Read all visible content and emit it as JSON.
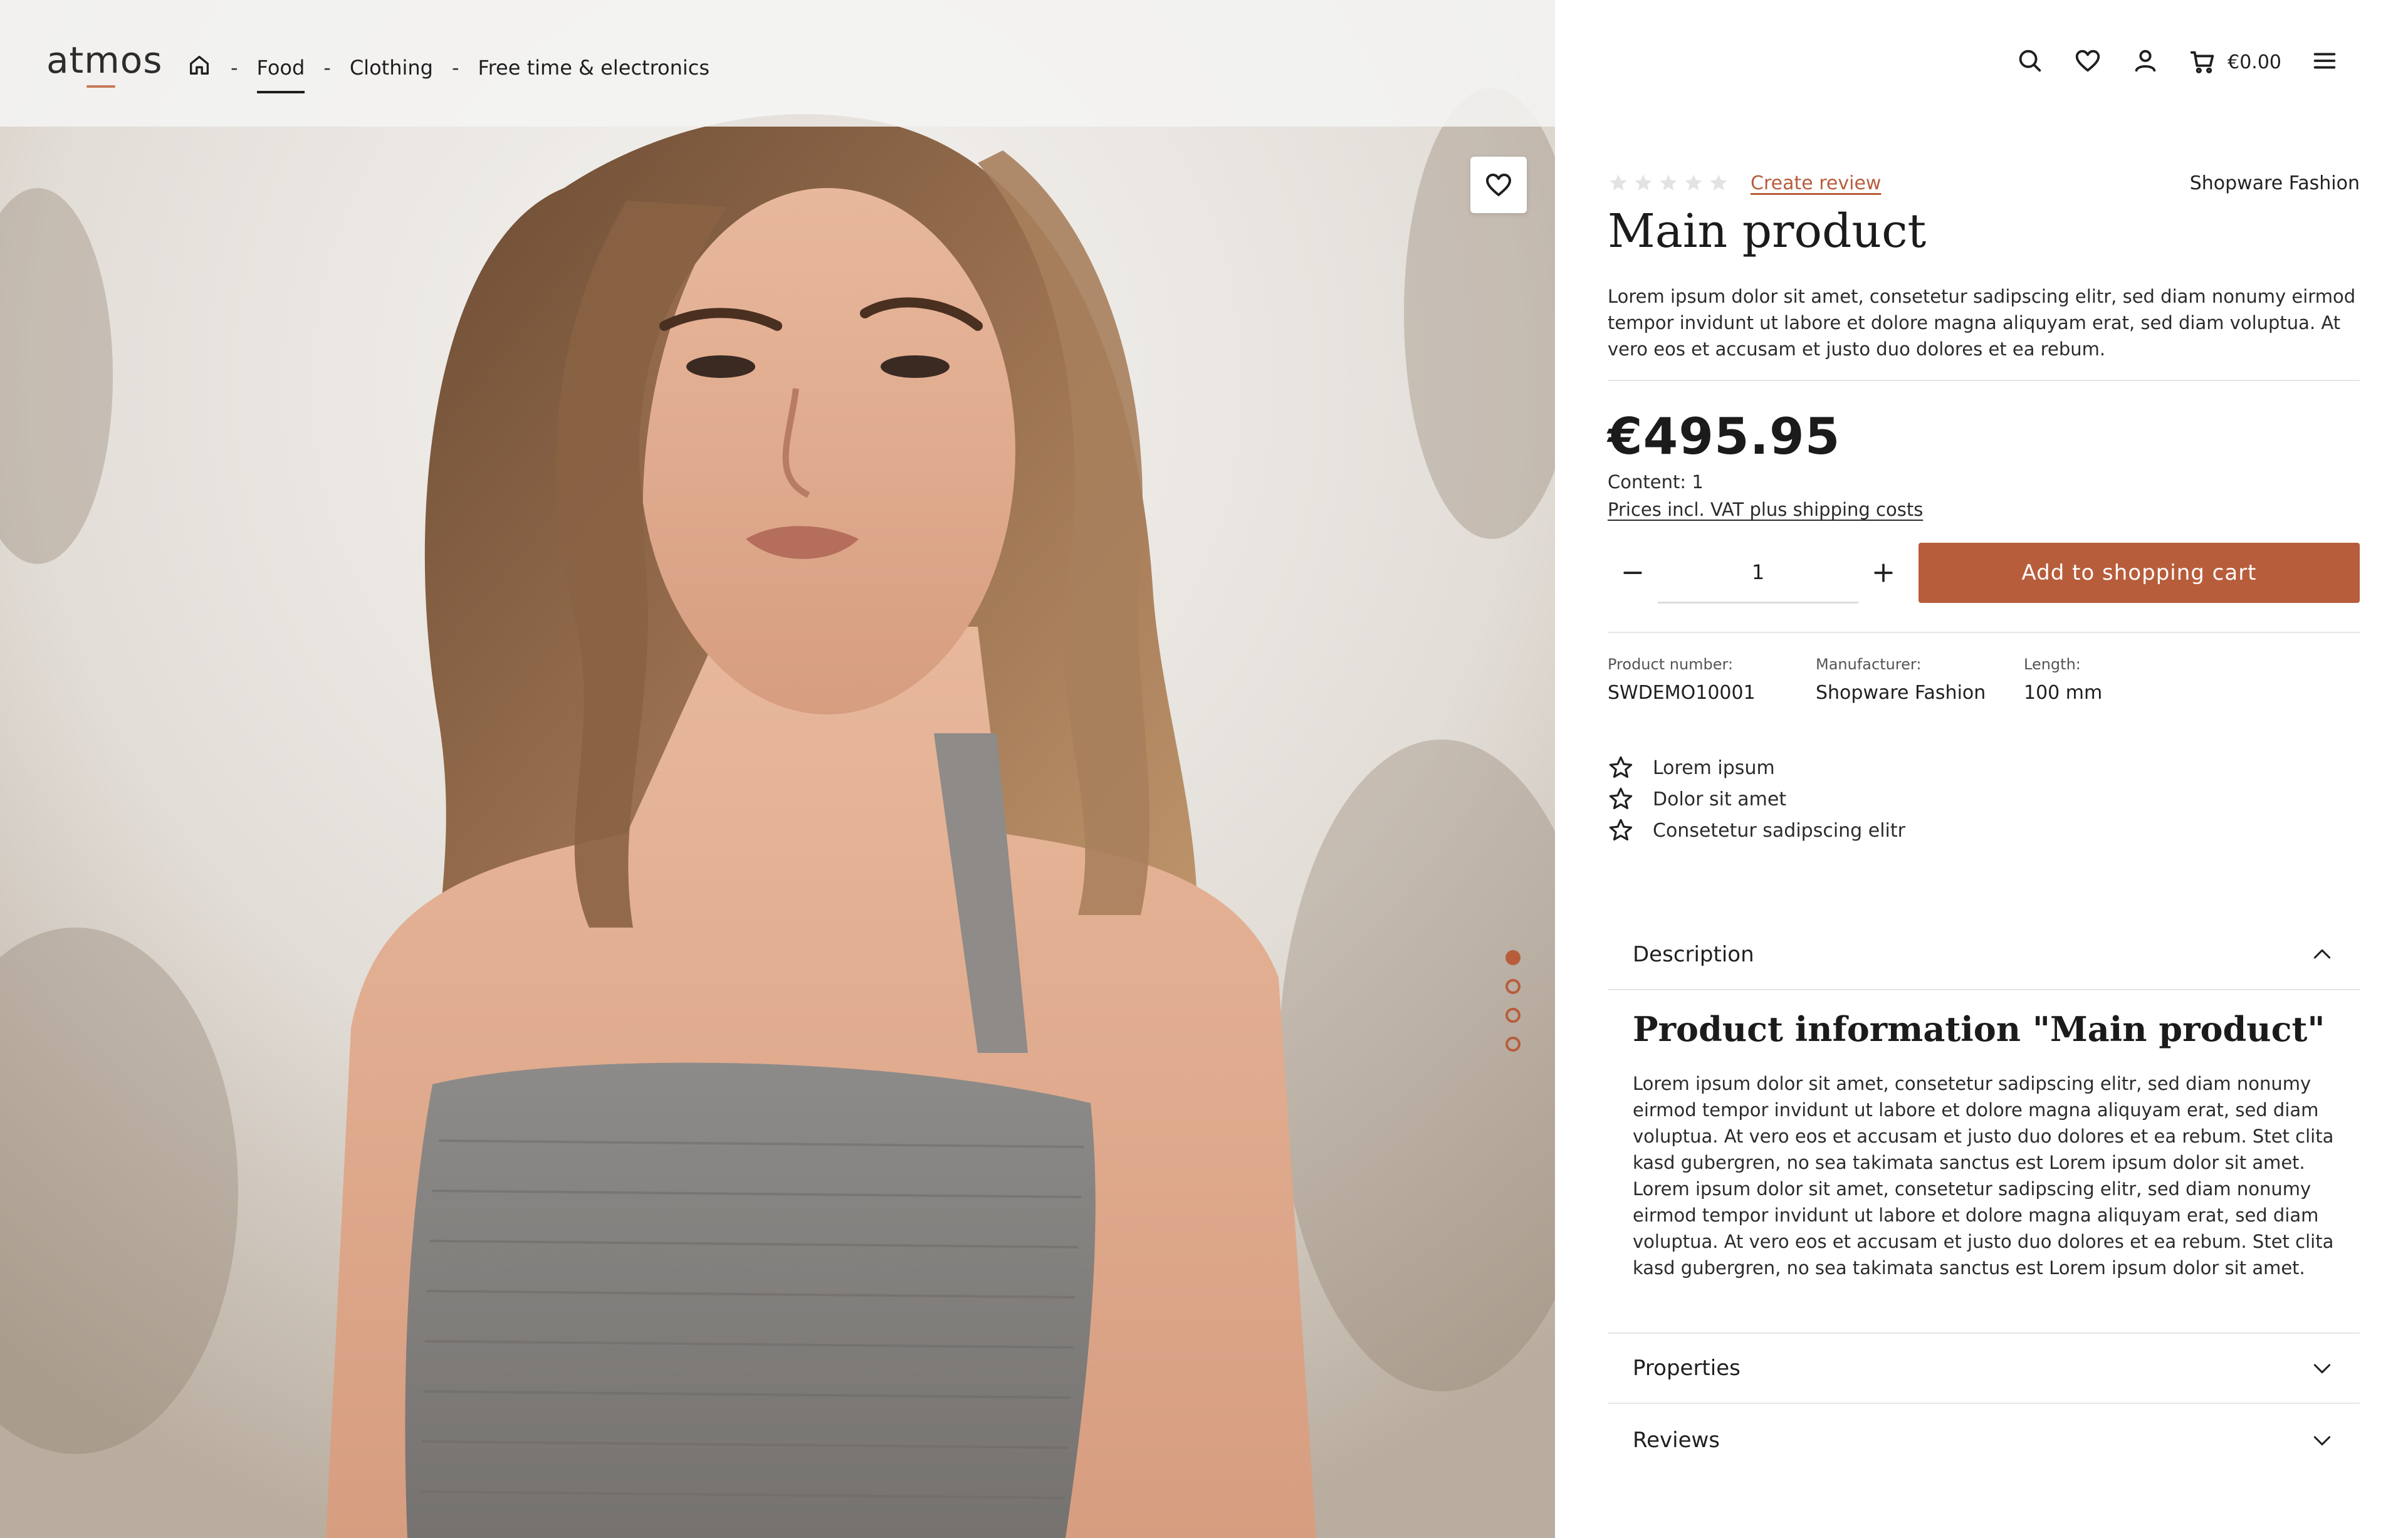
{
  "header": {
    "logo": "atmos",
    "breadcrumb": [
      "Food",
      "Clothing",
      "Free time & electronics"
    ],
    "cart_total": "€0.00"
  },
  "gallery": {
    "slide_count": 4,
    "active_slide": 1
  },
  "product": {
    "rating": 0,
    "create_review_label": "Create review",
    "brand": "Shopware Fashion",
    "title": "Main product",
    "short_description": "Lorem ipsum dolor sit amet, consetetur sadipscing elitr, sed diam nonumy eirmod tempor invidunt ut labore et dolore magna aliquyam erat, sed diam voluptua. At vero eos et accusam et justo duo dolores et ea rebum.",
    "price": "€495.95",
    "content": "Content: 1",
    "vat_note": "Prices incl. VAT plus shipping costs",
    "quantity": "1",
    "add_to_cart_label": "Add to shopping cart",
    "meta": [
      {
        "label": "Product number:",
        "value": "SWDEMO10001"
      },
      {
        "label": "Manufacturer:",
        "value": "Shopware Fashion"
      },
      {
        "label": "Length:",
        "value": "100 mm"
      }
    ],
    "features": [
      "Lorem ipsum",
      "Dolor sit amet",
      "Consetetur sadipscing elitr"
    ]
  },
  "accordion": {
    "description_label": "Description",
    "info_title": "Product information \"Main product\"",
    "info_text": "Lorem ipsum dolor sit amet, consetetur sadipscing elitr, sed diam nonumy eirmod tempor invidunt ut labore et dolore magna aliquyam erat, sed diam voluptua. At vero eos et accusam et justo duo dolores et ea rebum. Stet clita kasd gubergren, no sea takimata sanctus est Lorem ipsum dolor sit amet. Lorem ipsum dolor sit amet, consetetur sadipscing elitr, sed diam nonumy eirmod tempor invidunt ut labore et dolore magna aliquyam erat, sed diam voluptua. At vero eos et accusam et justo duo dolores et ea rebum. Stet clita kasd gubergren, no sea takimata sanctus est Lorem ipsum dolor sit amet.",
    "properties_label": "Properties",
    "reviews_label": "Reviews"
  },
  "colors": {
    "accent": "#b75d3b",
    "text": "#1f1f1f",
    "divider": "#e6e6e6"
  }
}
